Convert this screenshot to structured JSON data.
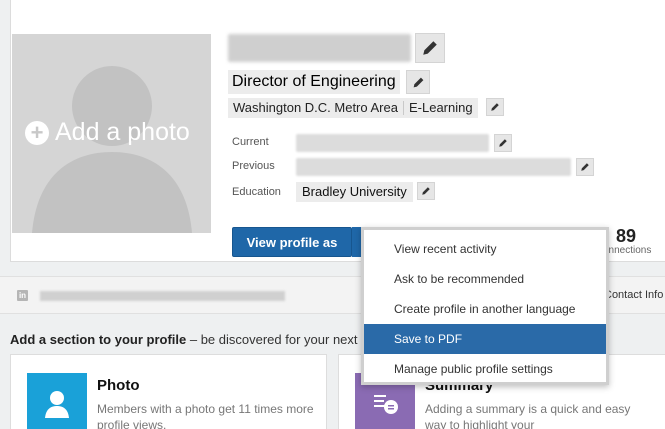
{
  "profile": {
    "add_photo_label": "Add a photo",
    "headline": "Director of Engineering",
    "location": "Washington D.C. Metro Area",
    "industry": "E-Learning",
    "labels": {
      "current": "Current",
      "previous": "Previous",
      "education": "Education"
    },
    "education": "Bradley University",
    "view_profile_button": "View profile as",
    "connections_count": "89",
    "connections_label": "connections"
  },
  "url_bar": {
    "contact_info": "Contact Info"
  },
  "add_section": {
    "title": "Add a section to your profile",
    "subtitle": " – be discovered for your next"
  },
  "tiles": [
    {
      "title": "Photo",
      "description": "Members with a photo get 11 times more profile views."
    },
    {
      "title": "Summary",
      "description": "Adding a summary is a quick and easy way to highlight your"
    }
  ],
  "dropdown": {
    "items": [
      "View recent activity",
      "Ask to be recommended",
      "Create profile in another language",
      "Save to PDF",
      "Manage public profile settings"
    ],
    "selected_index": 3
  },
  "colors": {
    "accent": "#1f67a8",
    "selected": "#2a6aa8",
    "photo_tile": "#1aa1d8",
    "summary_tile": "#8a6bb3"
  }
}
